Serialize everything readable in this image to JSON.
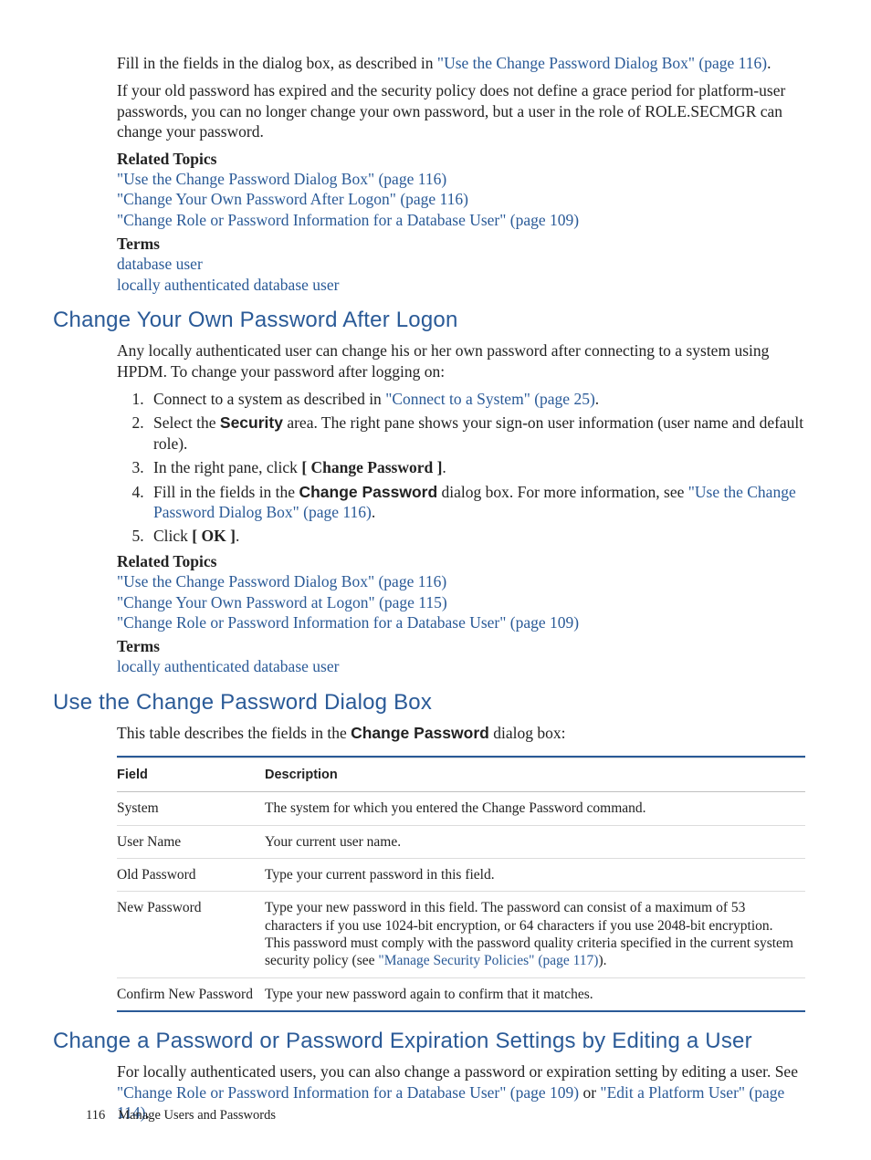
{
  "intro": {
    "p1a": "Fill in the fields in the dialog box, as described in ",
    "p1b": "\"Use the Change Password Dialog Box\" (page 116)",
    "p1c": ".",
    "p2": "If your old password has expired and the security policy does not define a grace period for platform-user passwords, you can no longer change your own password, but a user in the role of ROLE.SECMGR can change your password.",
    "rel_head": "Related Topics",
    "links": [
      "\"Use the Change Password Dialog Box\" (page 116)",
      "\"Change Your Own Password After Logon\" (page 116)",
      "\"Change Role or Password Information for a Database User\" (page 109)"
    ],
    "terms_head": "Terms",
    "terms": [
      "database user",
      "locally authenticated database user"
    ]
  },
  "sec1": {
    "title": "Change Your Own Password After Logon",
    "p1": "Any locally authenticated user can change his or her own password after connecting to a system using HPDM. To change your password after logging on:",
    "steps": {
      "s1a": "Connect to a system as described in ",
      "s1b": "\"Connect to a System\" (page 25)",
      "s1c": ".",
      "s2a": "Select the ",
      "s2b": "Security",
      "s2c": " area. The right pane shows your sign-on user information (user name and default role).",
      "s3a": "In the right pane, click ",
      "s3b": "[ Change Password ]",
      "s3c": ".",
      "s4a": "Fill in the fields in the ",
      "s4b": "Change Password",
      "s4c": " dialog box. For more information, see ",
      "s4d": "\"Use the Change Password Dialog Box\" (page 116)",
      "s4e": ".",
      "s5a": "Click ",
      "s5b": "[ OK ]",
      "s5c": "."
    },
    "rel_head": "Related Topics",
    "links": [
      "\"Use the Change Password Dialog Box\" (page 116)",
      "\"Change Your Own Password at Logon\" (page 115)",
      "\"Change Role or Password Information for a Database User\" (page 109)"
    ],
    "terms_head": "Terms",
    "terms": [
      "locally authenticated database user"
    ]
  },
  "sec2": {
    "title": "Use the Change Password Dialog Box",
    "p1a": "This table describes the fields in the ",
    "p1b": "Change Password",
    "p1c": " dialog box:",
    "table": {
      "h1": "Field",
      "h2": "Description",
      "rows": [
        {
          "f": "System",
          "d": "The system for which you entered the Change Password command."
        },
        {
          "f": "User Name",
          "d": "Your current user name."
        },
        {
          "f": "Old Password",
          "d": "Type your current password in this field."
        },
        {
          "f": "New Password",
          "d_a": "Type your new password in this field. The password can consist of a maximum of 53 characters if you use 1024-bit encryption, or 64 characters if you use 2048-bit encryption. This password must comply with the password quality criteria specified in the current system security policy (see ",
          "d_b": "\"Manage Security Policies\" (page 117)",
          "d_c": ")."
        },
        {
          "f": "Confirm New Password",
          "d": "Type your new password again to confirm that it matches."
        }
      ]
    }
  },
  "sec3": {
    "title": "Change a Password or Password Expiration Settings by Editing a User",
    "p1a": "For locally authenticated users, you can also change a password or expiration setting by editing a user. See ",
    "p1b": "\"Change Role or Password Information for a Database User\" (page 109)",
    "p1c": " or ",
    "p1d": "\"Edit a Platform User\" (page 114)",
    "p1e": "."
  },
  "footer": {
    "page": "116",
    "chapter": "Manage Users and Passwords"
  }
}
